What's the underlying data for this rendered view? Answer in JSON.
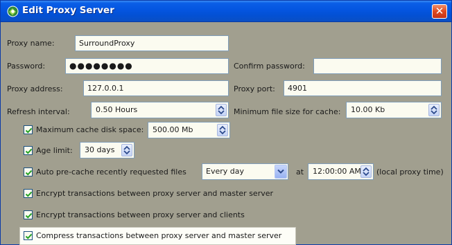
{
  "window": {
    "title": "Edit Proxy Server",
    "icon": "proxy-server-icon",
    "close_glyph": "✕"
  },
  "fields": {
    "proxy_name": {
      "label": "Proxy name:",
      "value": "SurroundProxy"
    },
    "password": {
      "label": "Password:",
      "value": "●●●●●●●●"
    },
    "confirm_password": {
      "label": "Confirm password:",
      "value": ""
    },
    "proxy_address": {
      "label": "Proxy address:",
      "value": "127.0.0.1"
    },
    "proxy_port": {
      "label": "Proxy port:",
      "value": "4901"
    },
    "refresh_interval": {
      "label": "Refresh interval:",
      "value": "0.50 Hours"
    },
    "min_file_size": {
      "label": "Minimum file size for cache:",
      "value": "10.00 Kb"
    }
  },
  "options": {
    "max_cache": {
      "label": "Maximum cache disk space:",
      "value": "500.00 Mb",
      "checked": true
    },
    "age_limit": {
      "label": "Age limit:",
      "value": "30 days",
      "checked": true
    },
    "auto_precache": {
      "label": "Auto pre-cache recently requested files",
      "schedule": "Every day",
      "at_label": "at",
      "time": "12:00:00 AM",
      "suffix": "(local proxy time)",
      "checked": true
    },
    "encrypt_master": {
      "label": "Encrypt transactions between proxy server and master server",
      "checked": true
    },
    "encrypt_clients": {
      "label": "Encrypt transactions between proxy server and clients",
      "checked": true
    },
    "compress_master": {
      "label": "Compress transactions between proxy server and master server",
      "checked": true
    }
  },
  "colors": {
    "titlebar": "#0455e0",
    "dialog_bg": "#a19f8f",
    "field_bg": "#fbfbf0",
    "close": "#e0481f"
  }
}
